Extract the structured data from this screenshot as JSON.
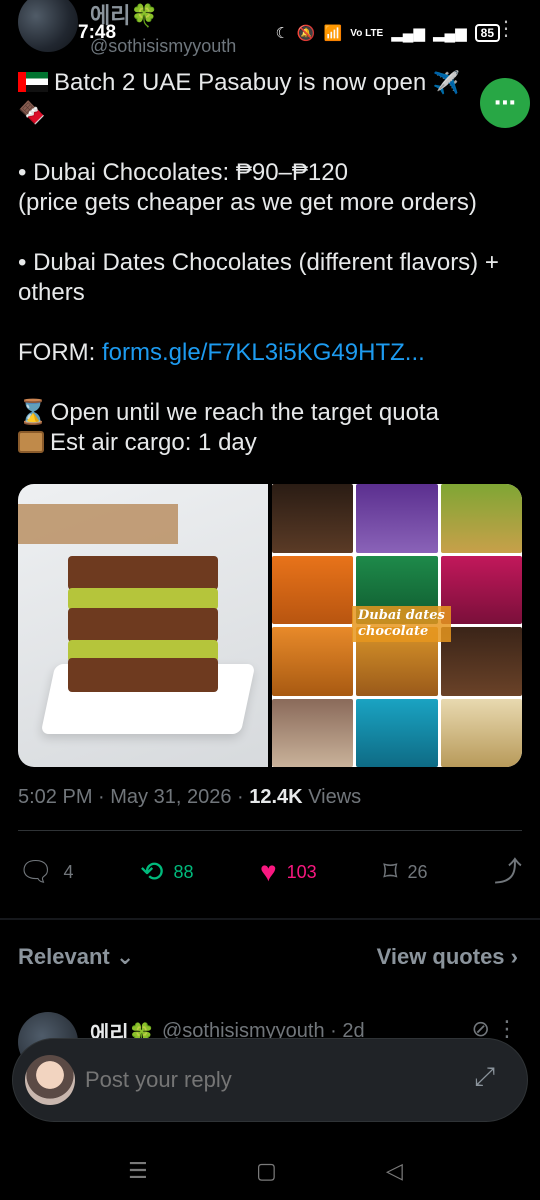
{
  "status_bar": {
    "time": "7:48",
    "battery": "85",
    "signal_text": "Vo LTE"
  },
  "header": {
    "author_name": "에리🍀",
    "handle": "@sothisismyyouth"
  },
  "fab": {
    "label": "⋯"
  },
  "tweet": {
    "line1": "Batch 2 UAE Pasabuy is now open",
    "line1_emoji": "✈️",
    "line2_emoji": "🍫",
    "bullet1": "• Dubai Chocolates: ₱90–₱120",
    "bullet1_note": "(price gets cheaper as we get more orders)",
    "bullet2": "• Dubai Dates Chocolates (different flavors) + others",
    "form_label": "FORM: ",
    "form_link": "forms.gle/F7KL3i5KG49HTZ...",
    "quota_line": "Open until we reach the target quota",
    "cargo_line": "Est air cargo: 1 day"
  },
  "media": {
    "overlay_line1": "Dubai dates",
    "overlay_line2": "chocolate"
  },
  "meta": {
    "time": "5:02 PM",
    "date": "May 31, 2026",
    "views_count": "12.4K",
    "views_label": "Views"
  },
  "actions": {
    "replies": "4",
    "retweets": "88",
    "likes": "103",
    "bookmarks": "26"
  },
  "replies_header": {
    "sort_label": "Relevant",
    "quotes_label": "View quotes"
  },
  "reply_preview": {
    "name": "에리🍀",
    "handle": "@sothisismyyouth · 2d"
  },
  "reply_box": {
    "placeholder": "Post your reply"
  },
  "colors": {
    "accent_link": "#1d9bf0",
    "retweet": "#00ba7c",
    "like": "#f91880",
    "fab": "#28a745"
  }
}
